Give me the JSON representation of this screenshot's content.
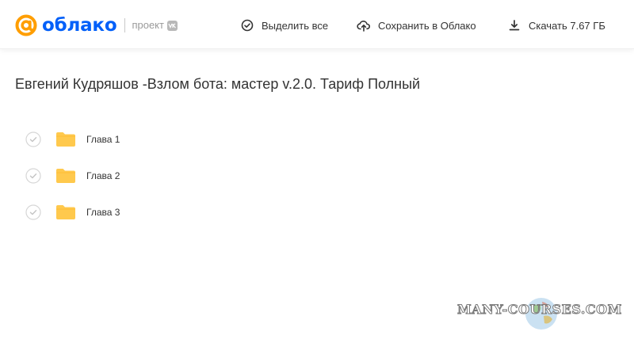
{
  "header": {
    "logo_text": "облако",
    "project_label": "проект",
    "toolbar": {
      "select_all": "Выделить все",
      "save_to_cloud": "Сохранить в Облако",
      "download": "Скачать 7.67 ГБ"
    }
  },
  "main": {
    "title": "Евгений Кудряшов -Взлом бота: мастер v.2.0. Тариф Полный",
    "items": [
      {
        "label": "Глава 1",
        "icon": "folder-icon"
      },
      {
        "label": "Глава 2",
        "icon": "folder-icon"
      },
      {
        "label": "Глава 3",
        "icon": "folder-icon"
      }
    ]
  },
  "watermark": {
    "text": "MANY-COURSES.COM"
  },
  "colors": {
    "brand": "#005ff9",
    "accent": "#ff9e00",
    "folder": "#ffc94d",
    "text": "#333333"
  }
}
